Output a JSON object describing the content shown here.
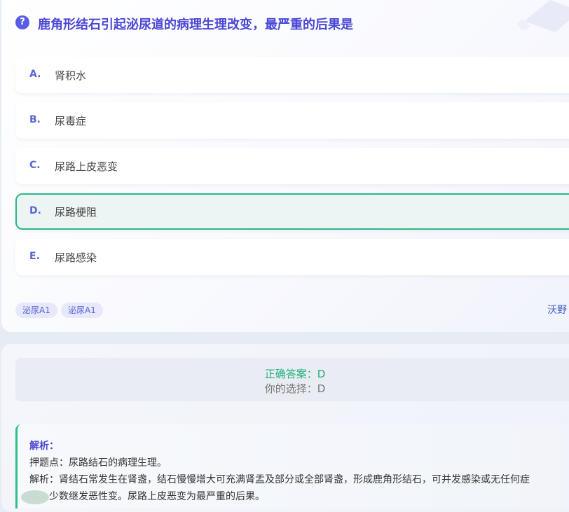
{
  "question": {
    "title": "鹿角形结石引起泌尿道的病理生理改变，最严重的后果是"
  },
  "options": [
    {
      "letter": "A.",
      "text": "肾积水"
    },
    {
      "letter": "B.",
      "text": "尿毒症"
    },
    {
      "letter": "C.",
      "text": "尿路上皮恶变"
    },
    {
      "letter": "D.",
      "text": "尿路梗阻",
      "selected": true
    },
    {
      "letter": "E.",
      "text": "尿路感染"
    }
  ],
  "tags": [
    "泌尿A1",
    "泌尿A1"
  ],
  "source": "沃野",
  "answer": {
    "correct": "正确答案：D",
    "yours": "你的选择：D"
  },
  "analysis": {
    "title": "解析：",
    "point": "押题点：尿路结石的病理生理。",
    "body": "解析：肾结石常发生在肾盏，结石慢慢增大可充满肾盂及部分或全部肾盏，形成鹿角形结石，可并发感染或无任何症",
    "body2": "状，少数继发恶性变。尿路上皮恶变为最严重的后果。"
  },
  "colors": {
    "accent": "#4a47d6",
    "correct": "#22b07c",
    "selected_border": "#2bb886"
  }
}
